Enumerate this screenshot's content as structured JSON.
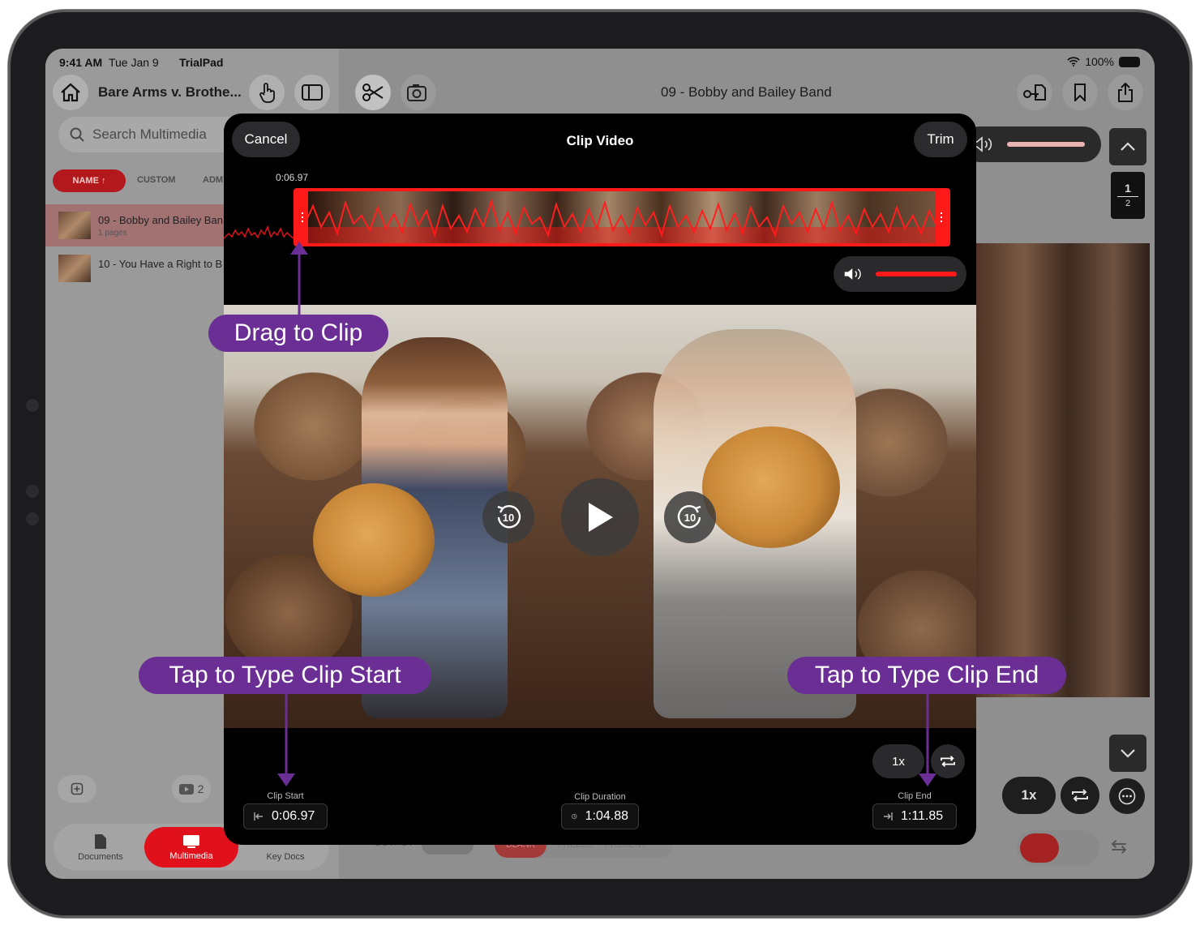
{
  "status": {
    "time": "9:41 AM",
    "date": "Tue Jan 9",
    "app": "TrialPad",
    "battery": "100%"
  },
  "sidebar": {
    "case_title": "Bare Arms v. Brothe...",
    "search_placeholder": "Search Multimedia",
    "sort_tabs": {
      "name": "NAME ↑",
      "custom": "CUSTOM",
      "adm": "ADM"
    },
    "files": [
      {
        "name": "09 - Bobby and Bailey Ban",
        "sub": "1 pages"
      },
      {
        "name": "10 - You Have a Right to B",
        "sub": ""
      }
    ],
    "video_count": "2",
    "tabs": {
      "documents": "Documents",
      "multimedia": "Multimedia",
      "key_docs": "Key Docs"
    }
  },
  "main": {
    "title": "09 - Bobby and Bailey Band",
    "page_current": "1",
    "page_total": "2",
    "speed": "1x",
    "bottom_labels": {
      "output": "OUTPUT",
      "blank": "BLANK",
      "freeze": "FREEZE",
      "present": "PRESENT"
    }
  },
  "clip": {
    "title": "Clip Video",
    "cancel": "Cancel",
    "trim": "Trim",
    "marker_time": "0:06.97",
    "speed": "1x",
    "skip_back": "10",
    "skip_fwd": "10",
    "clip_start_label": "Clip Start",
    "clip_start": "0:06.97",
    "clip_duration_label": "Clip Duration",
    "clip_duration": "1:04.88",
    "clip_end_label": "Clip End",
    "clip_end": "1:11.85"
  },
  "callouts": {
    "drag": "Drag to Clip",
    "start": "Tap to Type Clip Start",
    "end": "Tap to Type Clip End"
  },
  "colors": {
    "accent_red": "#e0111a",
    "callout_purple": "#6a2e95"
  }
}
